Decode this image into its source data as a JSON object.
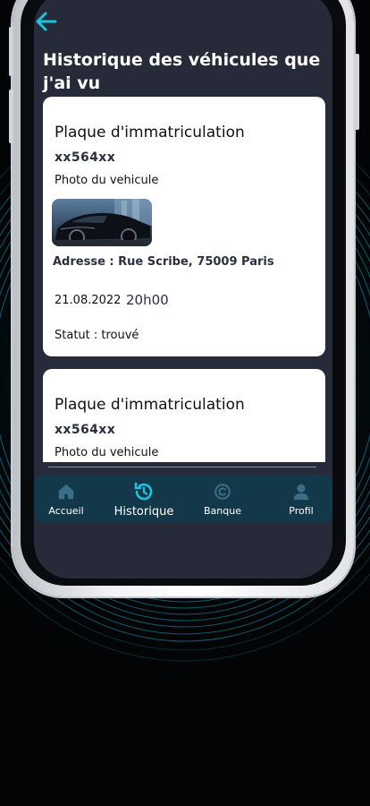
{
  "page": {
    "title": "Historique des véhicules que j'ai vu"
  },
  "colors": {
    "accent": "#1cc4e0",
    "background": "#272a39",
    "tabbar": "#123849",
    "card": "#ffffff",
    "text_dark": "#2b2f42"
  },
  "icons": {
    "back": "arrow-left-icon"
  },
  "cards": [
    {
      "title": "Plaque d'immatriculation",
      "plate": "xx564xx",
      "photo_label": "Photo du vehicule",
      "address": "Adresse : Rue Scribe, 75009 Paris",
      "date": "21.08.2022",
      "time": "20h00",
      "status": "Statut : trouvé"
    },
    {
      "title": "Plaque d'immatriculation",
      "plate": "xx564xx",
      "photo_label": "Photo du vehicule"
    }
  ],
  "tabs": [
    {
      "label": "Accueil",
      "icon": "home-icon",
      "active": false
    },
    {
      "label": "Historique",
      "icon": "history-icon",
      "active": true
    },
    {
      "label": "Banque",
      "icon": "copyright-coin-icon",
      "active": false
    },
    {
      "label": "Profil",
      "icon": "user-icon",
      "active": false
    }
  ]
}
